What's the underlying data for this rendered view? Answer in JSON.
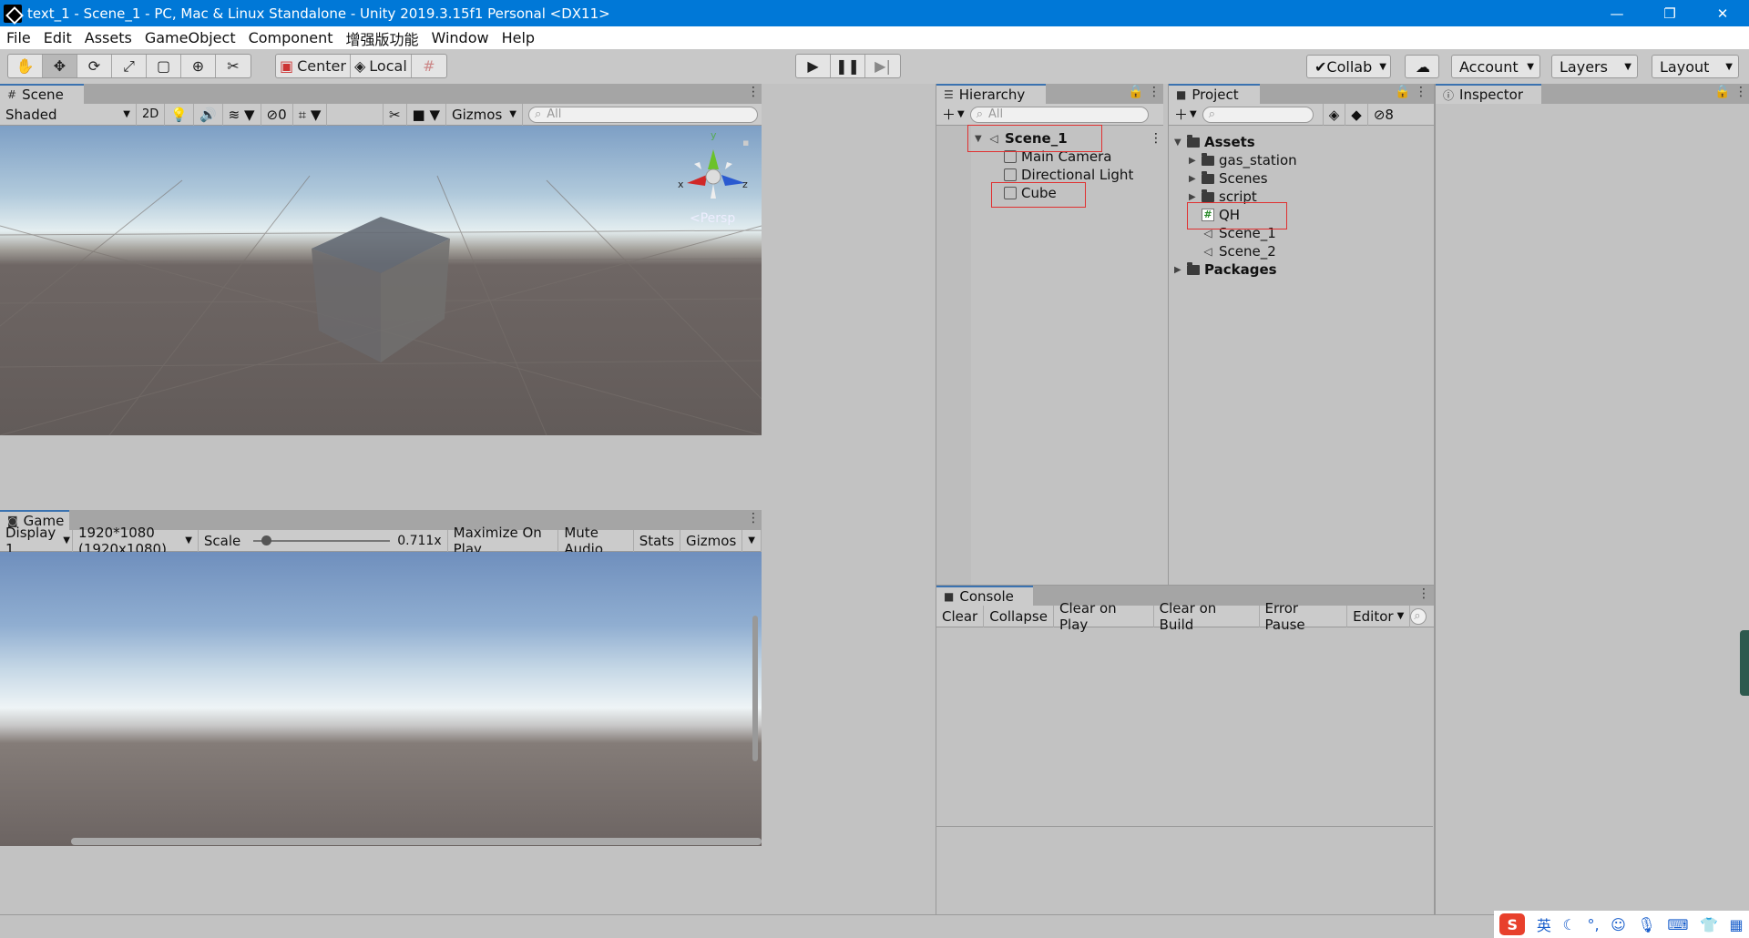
{
  "window": {
    "title": "text_1 - Scene_1 - PC, Mac & Linux Standalone - Unity 2019.3.15f1 Personal <DX11>",
    "min": "—",
    "max": "❐",
    "close": "✕"
  },
  "menu": [
    "File",
    "Edit",
    "Assets",
    "GameObject",
    "Component",
    "增强版功能",
    "Window",
    "Help"
  ],
  "toolbar": {
    "tools": [
      "hand-tool",
      "move-tool",
      "rotate-tool",
      "scale-tool",
      "rect-tool",
      "transform-tool",
      "custom-tool"
    ],
    "center_label": "Center",
    "local_label": "Local",
    "collab_label": "Collab",
    "account_label": "Account",
    "layers_label": "Layers",
    "layout_label": "Layout"
  },
  "scene": {
    "tab": "Scene",
    "shading": "Shaded",
    "mode2d": "2D",
    "hidden_count": "0",
    "gizmos": "Gizmos",
    "search_placeholder": "All",
    "persp": "<Persp",
    "axis_x": "x",
    "axis_y": "y",
    "axis_z": "z"
  },
  "game": {
    "tab": "Game",
    "display": "Display 1",
    "resolution": "1920*1080 (1920x1080)",
    "scale_label": "Scale",
    "scale_value": "0.711x",
    "scale_fraction": 0.09,
    "maximize": "Maximize On Play",
    "mute": "Mute Audio",
    "stats": "Stats",
    "gizmos": "Gizmos"
  },
  "hierarchy": {
    "tab": "Hierarchy",
    "search_placeholder": "All",
    "scene_name": "Scene_1",
    "objects": [
      "Main Camera",
      "Directional Light",
      "Cube"
    ]
  },
  "project": {
    "tab": "Project",
    "hidden_count": "8",
    "root": "Assets",
    "folders": [
      "gas_station",
      "Scenes",
      "script"
    ],
    "script": "QH",
    "scenes": [
      "Scene_1",
      "Scene_2"
    ],
    "packages": "Packages"
  },
  "inspector": {
    "tab": "Inspector"
  },
  "console": {
    "tab": "Console",
    "buttons": [
      "Clear",
      "Collapse",
      "Clear on Play",
      "Clear on Build",
      "Error Pause",
      "Editor"
    ]
  },
  "ime": {
    "lang": "英"
  },
  "colors": {
    "titlebar": "#0078d7",
    "highlight_box": "#e03030"
  }
}
